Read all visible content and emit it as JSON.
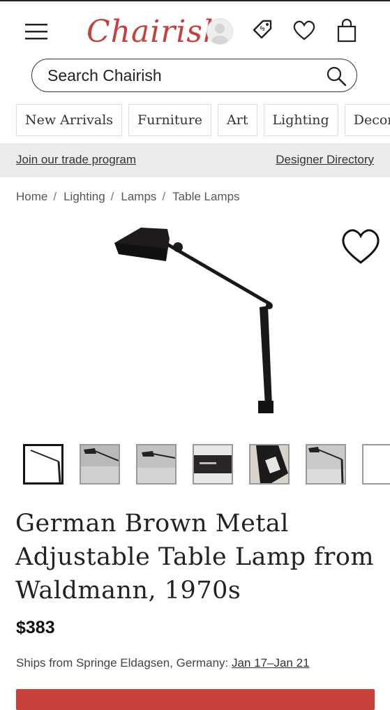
{
  "header": {
    "logo": "Chairish",
    "icons": [
      "menu-icon",
      "avatar",
      "tag-icon",
      "heart-icon",
      "bag-icon"
    ]
  },
  "search": {
    "placeholder": "Search Chairish"
  },
  "categories": [
    "New Arrivals",
    "Furniture",
    "Art",
    "Lighting",
    "Decor"
  ],
  "trade": {
    "left": "Join our trade program",
    "right": "Designer Directory"
  },
  "breadcrumb": {
    "items": [
      "Home",
      "Lighting",
      "Lamps",
      "Table Lamps"
    ],
    "separator": "/"
  },
  "gallery": {
    "thumbnail_count": 7,
    "active_index": 0
  },
  "product": {
    "title": "German Brown Metal Adjustable Table Lamp from Waldmann, 1970s",
    "price": "$383",
    "ships_prefix": "Ships from Springe Eldagsen, Germany: ",
    "ships_dates": "Jan 17–Jan 21"
  },
  "colors": {
    "brand": "#c3423f",
    "cta": "#c8423c",
    "trade_bar": "#ebebeb"
  }
}
